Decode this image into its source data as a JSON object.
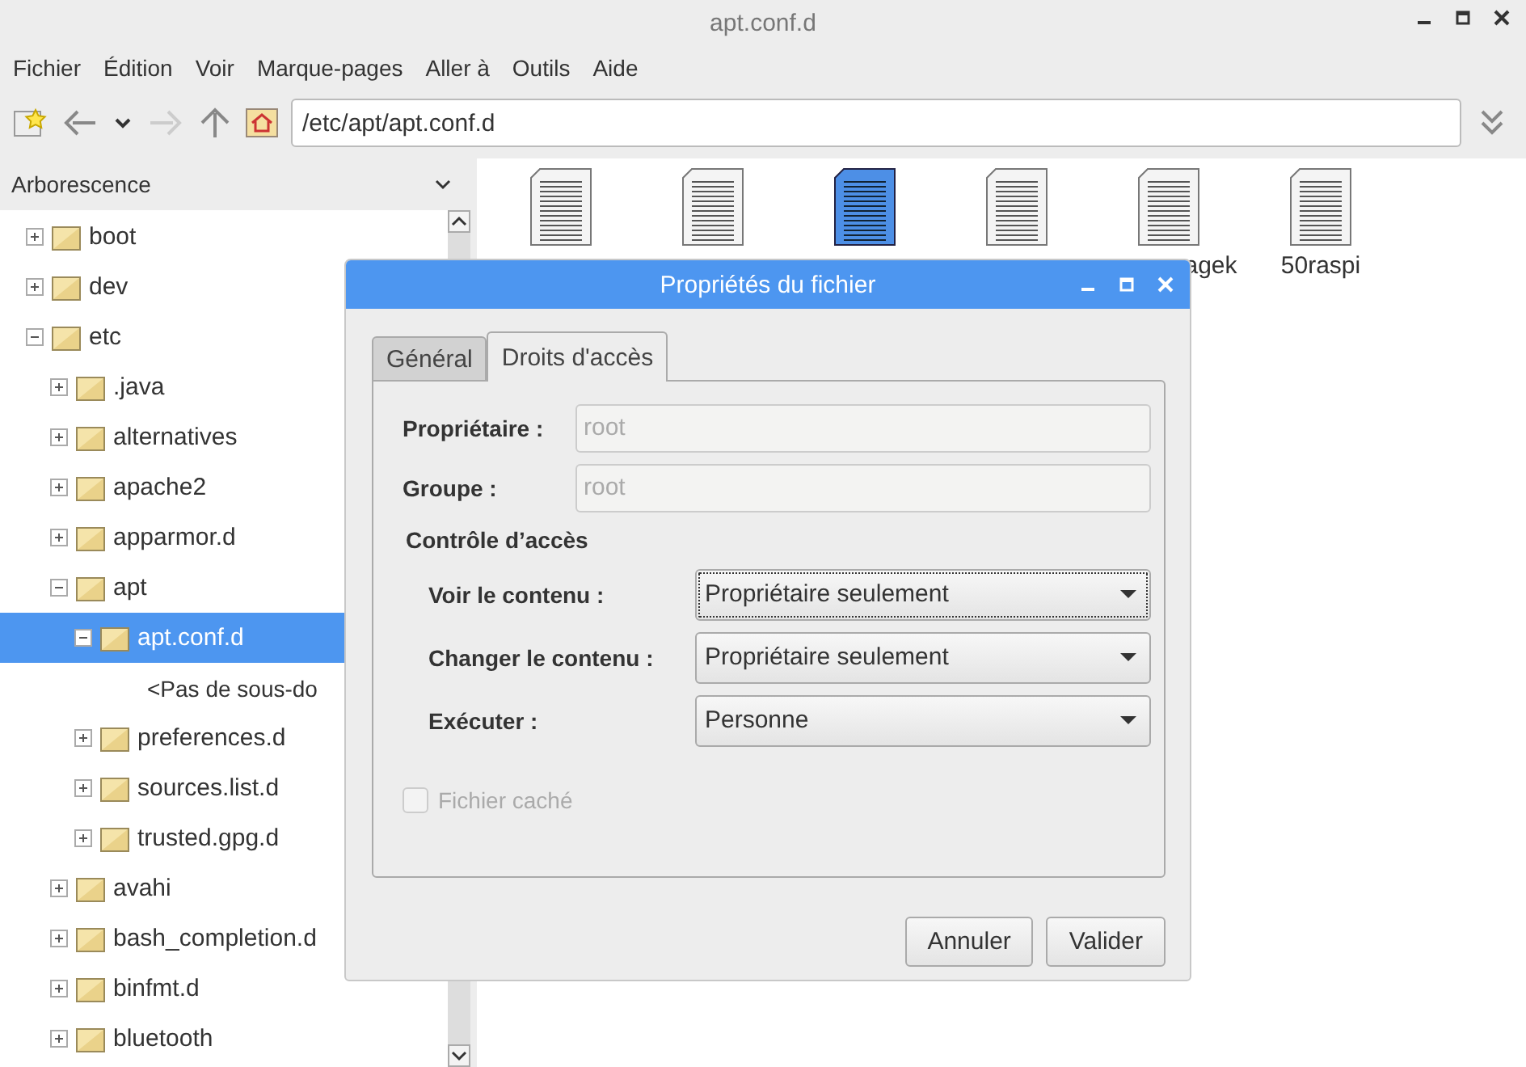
{
  "window": {
    "title": "apt.conf.d"
  },
  "menu": [
    "Fichier",
    "Édition",
    "Voir",
    "Marque-pages",
    "Aller à",
    "Outils",
    "Aide"
  ],
  "location": {
    "value": "/etc/apt/apt.conf.d"
  },
  "sidebar": {
    "title": "Arborescence",
    "tree": [
      {
        "label": "boot",
        "expanded": false,
        "selected": false
      },
      {
        "label": "dev",
        "expanded": false,
        "selected": false
      },
      {
        "label": "etc",
        "expanded": true,
        "selected": false,
        "children": [
          {
            "label": ".java",
            "expanded": false,
            "selected": false
          },
          {
            "label": "alternatives",
            "expanded": false,
            "selected": false
          },
          {
            "label": "apache2",
            "expanded": false,
            "selected": false
          },
          {
            "label": "apparmor.d",
            "expanded": false,
            "selected": false
          },
          {
            "label": "apt",
            "expanded": true,
            "selected": false,
            "children": [
              {
                "label": "apt.conf.d",
                "expanded": true,
                "selected": true,
                "children": [
                  {
                    "kind": "note",
                    "label": "<Pas de sous-do"
                  }
                ]
              },
              {
                "label": "preferences.d",
                "expanded": false,
                "selected": false
              },
              {
                "label": "sources.list.d",
                "expanded": false,
                "selected": false
              },
              {
                "label": "trusted.gpg.d",
                "expanded": false,
                "selected": false
              }
            ]
          },
          {
            "label": "avahi",
            "expanded": false,
            "selected": false
          },
          {
            "label": "bash_completion.d",
            "expanded": false,
            "selected": false
          },
          {
            "label": "binfmt.d",
            "expanded": false,
            "selected": false
          },
          {
            "label": "bluetooth",
            "expanded": false,
            "selected": false
          }
        ]
      }
    ]
  },
  "files": [
    {
      "selected": false
    },
    {
      "selected": false
    },
    {
      "selected": true
    },
    {
      "selected": false
    },
    {
      "selected": false,
      "label": "agek"
    },
    {
      "selected": false,
      "label": "50raspi"
    }
  ],
  "dialog": {
    "title": "Propriétés du fichier",
    "tabs": [
      {
        "label": "Général",
        "selected": false
      },
      {
        "label": "Droits d'accès",
        "selected": true
      }
    ],
    "fields": [
      {
        "label": "Propriétaire :",
        "value": "root",
        "disabled": true
      },
      {
        "label": "Groupe :",
        "value": "root",
        "disabled": true
      }
    ],
    "section": "Contrôle d’accès",
    "selects": [
      {
        "label": "Voir le contenu :",
        "value": "Propriétaire seulement",
        "focused": true
      },
      {
        "label": "Changer le contenu :",
        "value": "Propriétaire seulement",
        "focused": false
      },
      {
        "label": "Exécuter :",
        "value": "Personne",
        "focused": false
      }
    ],
    "hidden_file": {
      "label": "Fichier caché",
      "checked": false,
      "disabled": true
    },
    "buttons": [
      "Annuler",
      "Valider"
    ]
  }
}
